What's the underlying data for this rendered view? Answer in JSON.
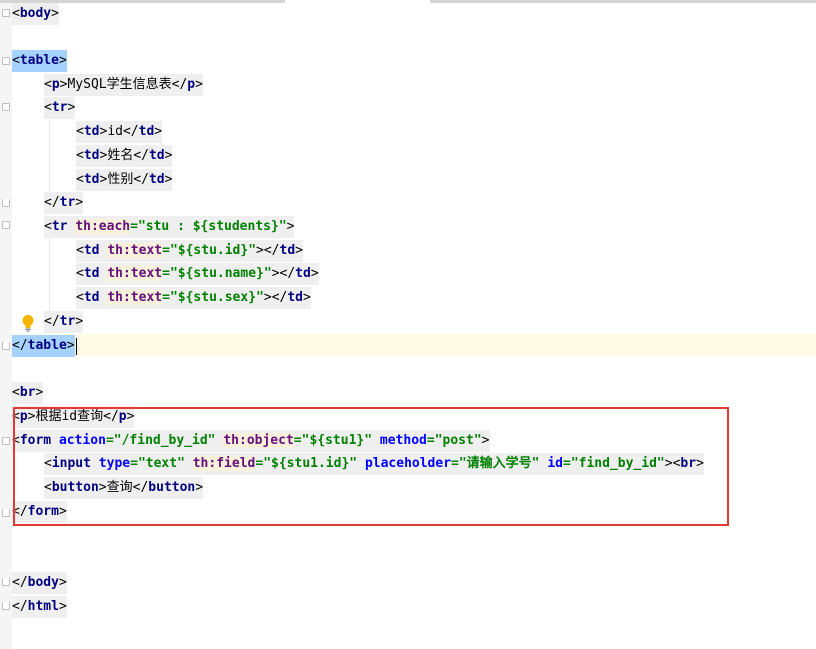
{
  "code_lines": {
    "l1": {
      "lt": "<",
      "tag": "body",
      "gt": ">"
    },
    "l2": {
      "lt": "<",
      "tag": "table",
      "gt": ">"
    },
    "l3": {
      "lt1": "<",
      "tag1": "p",
      "gt1": ">",
      "text": "MySQL学生信息表",
      "lt2": "</",
      "tag2": "p",
      "gt2": ">"
    },
    "l4": {
      "lt": "<",
      "tag": "tr",
      "gt": ">"
    },
    "l5": {
      "lt1": "<",
      "tag1": "td",
      "gt1": ">",
      "text": "id",
      "lt2": "</",
      "tag2": "td",
      "gt2": ">"
    },
    "l6": {
      "lt1": "<",
      "tag1": "td",
      "gt1": ">",
      "text": "姓名",
      "lt2": "</",
      "tag2": "td",
      "gt2": ">"
    },
    "l7": {
      "lt1": "<",
      "tag1": "td",
      "gt1": ">",
      "text": "性别",
      "lt2": "</",
      "tag2": "td",
      "gt2": ">"
    },
    "l8": {
      "lt": "</",
      "tag": "tr",
      "gt": ">"
    },
    "l9": {
      "lt": "<",
      "tag": "tr",
      "sp": " ",
      "attr": "th:each",
      "eq": "=",
      "val": "\"stu : ${students}\"",
      "gt": ">"
    },
    "l10": {
      "lt": "<",
      "tag": "td",
      "sp": " ",
      "attr": "th:text",
      "eq": "=",
      "val": "\"${stu.id}\"",
      "gt": ">",
      "lt2": "</",
      "tag2": "td",
      "gt2": ">"
    },
    "l11": {
      "lt": "<",
      "tag": "td",
      "sp": " ",
      "attr": "th:text",
      "eq": "=",
      "val": "\"${stu.name}\"",
      "gt": ">",
      "lt2": "</",
      "tag2": "td",
      "gt2": ">"
    },
    "l12": {
      "lt": "<",
      "tag": "td",
      "sp": " ",
      "attr": "th:text",
      "eq": "=",
      "val": "\"${stu.sex}\"",
      "gt": ">",
      "lt2": "</",
      "tag2": "td",
      "gt2": ">"
    },
    "l13": {
      "lt": "</",
      "tag": "tr",
      "gt": ">"
    },
    "l14": {
      "lt": "</",
      "tag": "table",
      "gt": ">"
    },
    "l15": {
      "lt": "<",
      "tag": "br",
      "gt": ">"
    },
    "l16": {
      "lt1": "<",
      "tag1": "p",
      "gt1": ">",
      "text": "根据id查询",
      "lt2": "</",
      "tag2": "p",
      "gt2": ">"
    },
    "l17": {
      "lt": "<",
      "tag": "form",
      "sp": " ",
      "a1": "action",
      "eq1": "=",
      "v1": "\"/find_by_id\"",
      "sp1": " ",
      "a2": "th:object",
      "eq2": "=",
      "v2": "\"${stu1}\"",
      "sp2": " ",
      "a3": "method",
      "eq3": "=",
      "v3": "\"post\"",
      "gt": ">"
    },
    "l18": {
      "lt": "<",
      "tag": "input",
      "sp": " ",
      "a1": "type",
      "eq1": "=",
      "v1": "\"text\"",
      "sp1": " ",
      "a2": "th:field",
      "eq2": "=",
      "v2": "\"${stu1.id}\"",
      "sp2": " ",
      "a3": "placeholder",
      "eq3": "=",
      "v3": "\"请输入学号\"",
      "sp3": " ",
      "a4": "id",
      "eq4": "=",
      "v4": "\"find_by_id\"",
      "gt": ">",
      "lt2": "<",
      "tag2": "br",
      "gt2": ">"
    },
    "l19": {
      "lt1": "<",
      "tag1": "button",
      "gt1": ">",
      "text": "查询",
      "lt2": "</",
      "tag2": "button",
      "gt2": ">"
    },
    "l20": {
      "lt": "</",
      "tag": "form",
      "gt": ">"
    },
    "l21": {
      "lt": "</",
      "tag": "body",
      "gt": ">"
    },
    "l22": {
      "lt": "</",
      "tag": "html",
      "gt": ">"
    }
  },
  "icons": {
    "bulb": "lightbulb-icon",
    "fold": "fold-marker-icon"
  },
  "colors": {
    "tag": "#000080",
    "attribute": "#0000ff",
    "thymeleaf_attribute": "#660e7a",
    "value": "#008000",
    "highlight_box": "#e53935",
    "caret_line": "#fffae3",
    "selection": "#a6d2ff"
  }
}
